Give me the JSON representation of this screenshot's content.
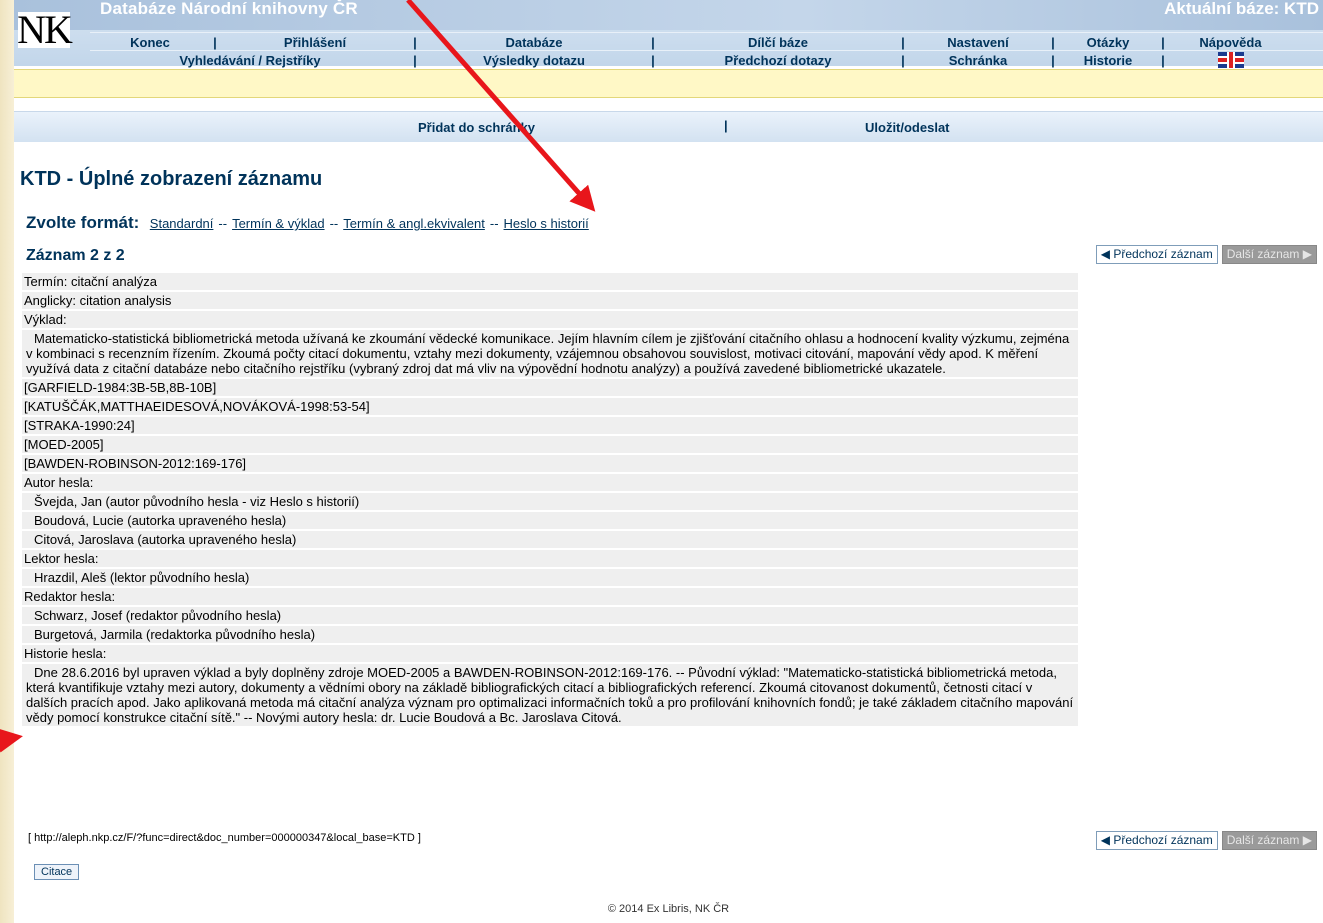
{
  "header": {
    "db_title": "Databáze Národní knihovny ČR",
    "current_base": "Aktuální báze: KTD",
    "logo_text": "NK",
    "nav1": [
      "Konec",
      "Přihlášení",
      "Databáze",
      "Dílčí báze",
      "Nastavení",
      "Otázky",
      "Nápověda"
    ],
    "nav2": [
      "Vyhledávání / Rejstříky",
      "Výsledky dotazu",
      "Předchozí dotazy",
      "Schránka",
      "Historie"
    ],
    "flag_icon": "uk-flag-icon"
  },
  "actions": {
    "add_to_basket": "Přidat do schránky",
    "save_send": "Uložit/odeslat"
  },
  "page_title": "KTD - Úplné zobrazení záznamu",
  "format": {
    "label": "Zvolte formát:",
    "options": [
      "Standardní",
      "Termín & výklad",
      "Termín & angl.ekvivalent",
      "Heslo s historií"
    ]
  },
  "record": {
    "count": "Záznam 2 z 2",
    "prev": "◀ Předchozí záznam",
    "next": "Další záznam ▶",
    "rows": [
      "Termín: citační analýza",
      "Anglicky: citation analysis",
      "Výklad:",
      "Matematicko-statistická bibliometrická metoda užívaná ke zkoumání vědecké komunikace. Jejím hlavním cílem je zjišťování citačního ohlasu a hodnocení kvality výzkumu, zejména v kombinaci s recenzním řízením. Zkoumá počty citací dokumentu, vztahy mezi dokumenty, vzájemnou obsahovou souvislost, motivaci citování, mapování vědy apod. K měření využívá data z citační databáze nebo citačního rejstříku (vybraný zdroj dat má vliv na výpovědní hodnotu analýzy) a používá zavedené bibliometrické ukazatele.",
      "[GARFIELD-1984:3B-5B,8B-10B]",
      "[KATUŠČÁK,MATTHAEIDESOVÁ,NOVÁKOVÁ-1998:53-54]",
      "[STRAKA-1990:24]",
      "[MOED-2005]",
      "[BAWDEN-ROBINSON-2012:169-176]",
      "Autor hesla:",
      "Švejda, Jan (autor původního hesla - viz Heslo s historií)",
      "Boudová, Lucie (autorka upraveného hesla)",
      "Citová, Jaroslava (autorka upraveného hesla)",
      "Lektor hesla:",
      "Hrazdil, Aleš (lektor původního hesla)",
      "Redaktor hesla:",
      "Schwarz, Josef (redaktor původního hesla)",
      "Burgetová, Jarmila (redaktorka původního hesla)",
      "Historie hesla:",
      "Dne 28.6.2016 byl upraven výklad a byly doplněny zdroje MOED-2005 a BAWDEN-ROBINSON-2012:169-176. -- Původní výklad: \"Matematicko-statistická bibliometrická metoda, která kvantifikuje vztahy mezi autory, dokumenty a vědními obory na základě bibliografických citací a bibliografických referencí. Zkoumá citovanost dokumentů, četnosti citací v dalších pracích apod. Jako aplikovaná metoda má citační analýza význam pro optimalizaci informačních toků a pro profilování knihovních fondů; je také základem citačního mapování vědy pomocí konstrukce citační sítě.\" -- Novými autory hesla: dr. Lucie Boudová a Bc. Jaroslava Citová."
    ],
    "row_kinds": [
      "plain",
      "plain",
      "plain",
      "para",
      "plain",
      "plain",
      "plain",
      "plain",
      "plain",
      "plain",
      "ind",
      "ind",
      "ind",
      "plain",
      "ind",
      "plain",
      "ind",
      "ind",
      "plain",
      "para"
    ],
    "permalink": "[ http://aleph.nkp.cz/F/?func=direct&doc_number=000000347&local_base=KTD ]",
    "cite_button": "Citace"
  },
  "footer": "© 2014 Ex Libris, NK ČR",
  "colors": {
    "accent": "#00335a",
    "annotation_arrow": "#e8161b",
    "highlight_bar": "#fff8c6"
  }
}
